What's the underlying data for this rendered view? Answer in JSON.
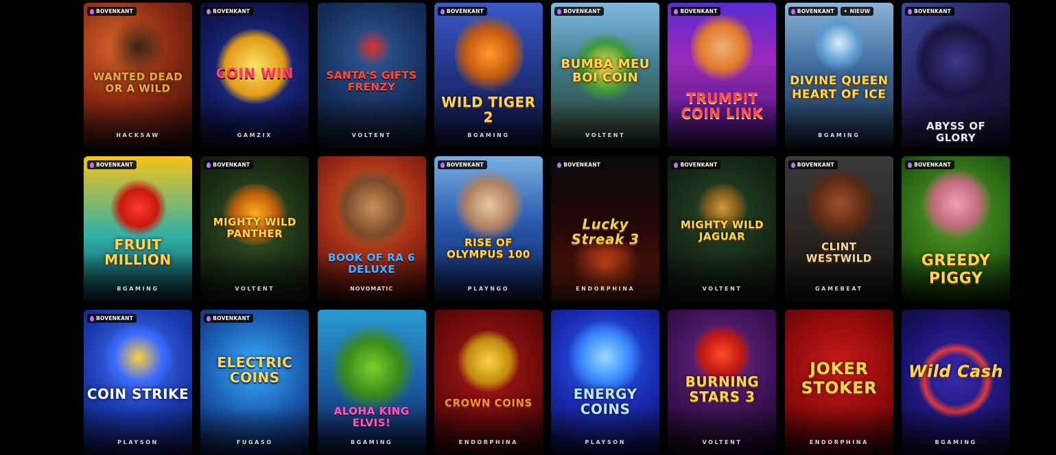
{
  "badges": {
    "top": "BOVENKANT",
    "new": "NIEUW"
  },
  "games": [
    {
      "title": "Wanted Dead or a Wild",
      "provider": "HACKSAW",
      "top": true,
      "new": false
    },
    {
      "title": "Coin Win",
      "provider": "GAMZIX",
      "top": true,
      "new": false
    },
    {
      "title": "Santa's Gifts Frenzy",
      "provider": "VOLTENT",
      "top": false,
      "new": false
    },
    {
      "title": "Wild Tiger 2",
      "provider": "BGAMING",
      "top": true,
      "new": false
    },
    {
      "title": "Bumba Meu Boi Coin",
      "provider": "VOLTENT",
      "top": true,
      "new": false
    },
    {
      "title": "Trumpit Coin Link",
      "provider": "",
      "top": true,
      "new": false
    },
    {
      "title": "Divine Queen Heart of Ice",
      "provider": "BGAMING",
      "top": true,
      "new": true
    },
    {
      "title": "Abyss of Glory",
      "provider": "",
      "top": true,
      "new": false
    },
    {
      "title": "Fruit Million",
      "provider": "BGAMING",
      "top": true,
      "new": false
    },
    {
      "title": "Mighty Wild Panther",
      "provider": "VOLTENT",
      "top": true,
      "new": false
    },
    {
      "title": "Book of Ra 6 Deluxe",
      "provider": "NOVOMATIC",
      "top": false,
      "new": false
    },
    {
      "title": "Rise of Olympus 100",
      "provider": "PLAYNGO",
      "top": true,
      "new": false
    },
    {
      "title": "Lucky Streak 3",
      "provider": "ENDORPHINA",
      "top": true,
      "new": false
    },
    {
      "title": "Mighty Wild Jaguar",
      "provider": "VOLTENT",
      "top": true,
      "new": false
    },
    {
      "title": "Clint Westwild",
      "provider": "GAMEBEAT",
      "top": true,
      "new": false
    },
    {
      "title": "Greedy Piggy",
      "provider": "",
      "top": true,
      "new": false
    },
    {
      "title": "Coin Strike",
      "provider": "PLAYSON",
      "top": true,
      "new": false
    },
    {
      "title": "Electric Coins",
      "provider": "FUGASO",
      "top": true,
      "new": false
    },
    {
      "title": "Aloha King Elvis!",
      "provider": "BGAMING",
      "top": false,
      "new": false
    },
    {
      "title": "Crown Coins",
      "provider": "ENDORPHINA",
      "top": false,
      "new": false
    },
    {
      "title": "Energy Coins",
      "provider": "PLAYSON",
      "top": false,
      "new": false
    },
    {
      "title": "Burning Stars 3",
      "provider": "VOLTENT",
      "top": false,
      "new": false
    },
    {
      "title": "Joker Stoker",
      "provider": "ENDORPHINA",
      "top": false,
      "new": false
    },
    {
      "title": "Wild Cash",
      "provider": "BGAMING",
      "top": false,
      "new": false
    }
  ],
  "colors": {
    "background": "#000000",
    "badge_flame": "#c86bff",
    "new_star": "#ffd54a"
  }
}
